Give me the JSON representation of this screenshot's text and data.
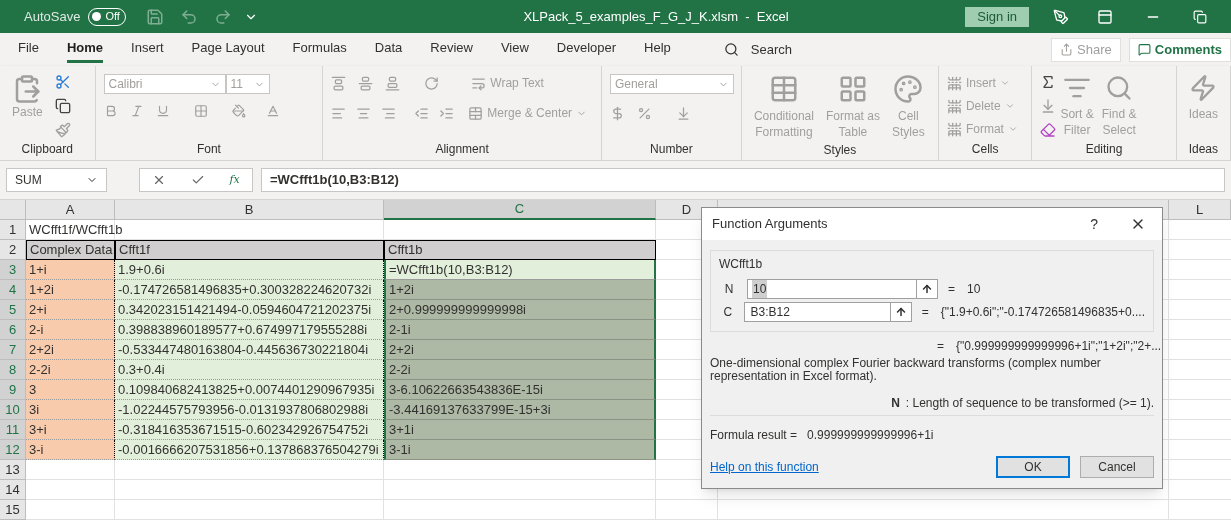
{
  "title_bar": {
    "autosave_label": "AutoSave",
    "autosave": {
      "label": "Off",
      "on": false
    },
    "title": "XLPack_5_examples_F_G_J_K.xlsm  -  Excel",
    "sign_in": "Sign in"
  },
  "menu_tabs": [
    {
      "label": "File",
      "selected": false
    },
    {
      "label": "Home",
      "selected": true
    },
    {
      "label": "Insert",
      "selected": false
    },
    {
      "label": "Page Layout",
      "selected": false
    },
    {
      "label": "Formulas",
      "selected": false
    },
    {
      "label": "Data",
      "selected": false
    },
    {
      "label": "Review",
      "selected": false
    },
    {
      "label": "View",
      "selected": false
    },
    {
      "label": "Developer",
      "selected": false
    },
    {
      "label": "Help",
      "selected": false
    }
  ],
  "search": "Search",
  "share": "Share",
  "comments": "Comments",
  "ribbon": {
    "clipboard": {
      "paste": "Paste",
      "label": "Clipboard"
    },
    "font": {
      "font_name": "Calibri",
      "font_size": "11",
      "label": "Font"
    },
    "alignment": {
      "wrap": "Wrap Text",
      "merge": "Merge & Center",
      "label": "Alignment"
    },
    "number": {
      "format": "General",
      "label": "Number"
    },
    "styles": {
      "items": [
        [
          "Conditional",
          "Formatting"
        ],
        [
          "Format as",
          "Table"
        ],
        [
          "Cell",
          "Styles"
        ]
      ],
      "label": "Styles"
    },
    "cells": {
      "items": [
        "Insert",
        "Delete",
        "Format"
      ],
      "label": "Cells"
    },
    "editing": {
      "items": [
        [
          "Sort &",
          "Filter"
        ],
        [
          "Find &",
          "Select"
        ]
      ],
      "label": "Editing"
    },
    "ideas": {
      "button": "Ideas",
      "label": "Ideas"
    }
  },
  "formula_bar": {
    "name_box": "SUM",
    "insert_function": "fx",
    "formula": "=WCfft1b(10,B3:B12)"
  },
  "sheet": {
    "columns": [
      {
        "label": "A",
        "selected": false
      },
      {
        "label": "B",
        "selected": false
      },
      {
        "label": "C",
        "selected": true
      },
      {
        "label": "D",
        "selected": false
      },
      {
        "label": "L",
        "selected": false
      }
    ],
    "rows": [
      {
        "number": "1",
        "selected": false,
        "cells": [
          {
            "text": "WCfft1f/WCfft1b",
            "kind": "plain"
          },
          {
            "kind": "plain"
          },
          {
            "kind": "plain"
          }
        ]
      },
      {
        "number": "2",
        "selected": false,
        "cells": [
          {
            "text": "Complex Data",
            "kind": "header"
          },
          {
            "text": "Cfft1f",
            "kind": "header"
          },
          {
            "text": "Cfft1b",
            "kind": "header"
          }
        ]
      },
      {
        "number": "3",
        "selected": true,
        "cells": [
          {
            "text": "1+i",
            "kind": "input"
          },
          {
            "text": "1.9+0.6i",
            "kind": "result"
          },
          {
            "text": "=WCfft1b(10,B3:B12)",
            "kind": "active"
          }
        ]
      },
      {
        "number": "4",
        "selected": true,
        "cells": [
          {
            "text": "1+2i",
            "kind": "input"
          },
          {
            "text": "-0.174726581496835+0.300328224620732i",
            "kind": "result"
          },
          {
            "text": "1+2i",
            "kind": "range"
          }
        ]
      },
      {
        "number": "5",
        "selected": true,
        "cells": [
          {
            "text": "2+i",
            "kind": "input"
          },
          {
            "text": "0.342023151421494-0.0594604721202375i",
            "kind": "result"
          },
          {
            "text": "2+0.999999999999998i",
            "kind": "range"
          }
        ]
      },
      {
        "number": "6",
        "selected": true,
        "cells": [
          {
            "text": "2-i",
            "kind": "input"
          },
          {
            "text": "0.398838960189577+0.674997179555288i",
            "kind": "result"
          },
          {
            "text": "2-1i",
            "kind": "range"
          }
        ]
      },
      {
        "number": "7",
        "selected": true,
        "cells": [
          {
            "text": "2+2i",
            "kind": "input"
          },
          {
            "text": "-0.533447480163804-0.445636730221804i",
            "kind": "result"
          },
          {
            "text": "2+2i",
            "kind": "range"
          }
        ]
      },
      {
        "number": "8",
        "selected": true,
        "cells": [
          {
            "text": "2-2i",
            "kind": "input"
          },
          {
            "text": "0.3+0.4i",
            "kind": "result"
          },
          {
            "text": "2-2i",
            "kind": "range"
          }
        ]
      },
      {
        "number": "9",
        "selected": true,
        "cells": [
          {
            "text": "3",
            "kind": "input"
          },
          {
            "text": "0.109840682413825+0.0074401290967935i",
            "kind": "result"
          },
          {
            "text": "3-6.10622663543836E-15i",
            "kind": "range"
          }
        ]
      },
      {
        "number": "10",
        "selected": true,
        "cells": [
          {
            "text": "3i",
            "kind": "input"
          },
          {
            "text": "-1.02244575793956-0.0131937806802988i",
            "kind": "result"
          },
          {
            "text": "-3.44169137633799E-15+3i",
            "kind": "range"
          }
        ]
      },
      {
        "number": "11",
        "selected": true,
        "cells": [
          {
            "text": "3+i",
            "kind": "input"
          },
          {
            "text": "-0.318416353671515-0.602342926754752i",
            "kind": "result"
          },
          {
            "text": "3+1i",
            "kind": "range"
          }
        ]
      },
      {
        "number": "12",
        "selected": true,
        "cells": [
          {
            "text": "3-i",
            "kind": "input"
          },
          {
            "text": "-0.0016666207531856+0.137868376504279i",
            "kind": "result"
          },
          {
            "text": "3-1i",
            "kind": "range"
          }
        ]
      },
      {
        "number": "13",
        "selected": false,
        "cells": [
          {
            "kind": "plain"
          },
          {
            "kind": "plain"
          },
          {
            "kind": "plain"
          }
        ]
      },
      {
        "number": "14",
        "selected": false,
        "cells": [
          {
            "kind": "plain"
          },
          {
            "kind": "plain"
          },
          {
            "kind": "plain"
          }
        ]
      },
      {
        "number": "15",
        "selected": false,
        "cells": [
          {
            "kind": "plain"
          },
          {
            "kind": "plain"
          },
          {
            "kind": "plain"
          }
        ]
      }
    ]
  },
  "dialog": {
    "title": "Function Arguments",
    "help": "?",
    "function_name": "WCfft1b",
    "args": [
      {
        "name": "N",
        "value": "10",
        "equals": "=",
        "result": "10"
      },
      {
        "name": "C",
        "value": "B3:B12",
        "equals": "=",
        "result": "{\"1.9+0.6i\";\"-0.174726581496835+0...."
      }
    ],
    "total_equals": "=",
    "total_result": "{\"0.999999999999996+1i\";\"1+2i\";\"2+...",
    "description": "One-dimensional complex Fourier backward transforms (complex number representation in Excel format).",
    "arg_help_name": "N",
    "arg_help": ": Length of sequence to be transformed (>= 1).",
    "formula_result_label": "Formula result =",
    "formula_result": "0.999999999999996+1i",
    "help_link": "Help on this function",
    "buttons": [
      {
        "label": "OK",
        "kind": "default"
      },
      {
        "label": "Cancel",
        "kind": "normal"
      }
    ]
  }
}
